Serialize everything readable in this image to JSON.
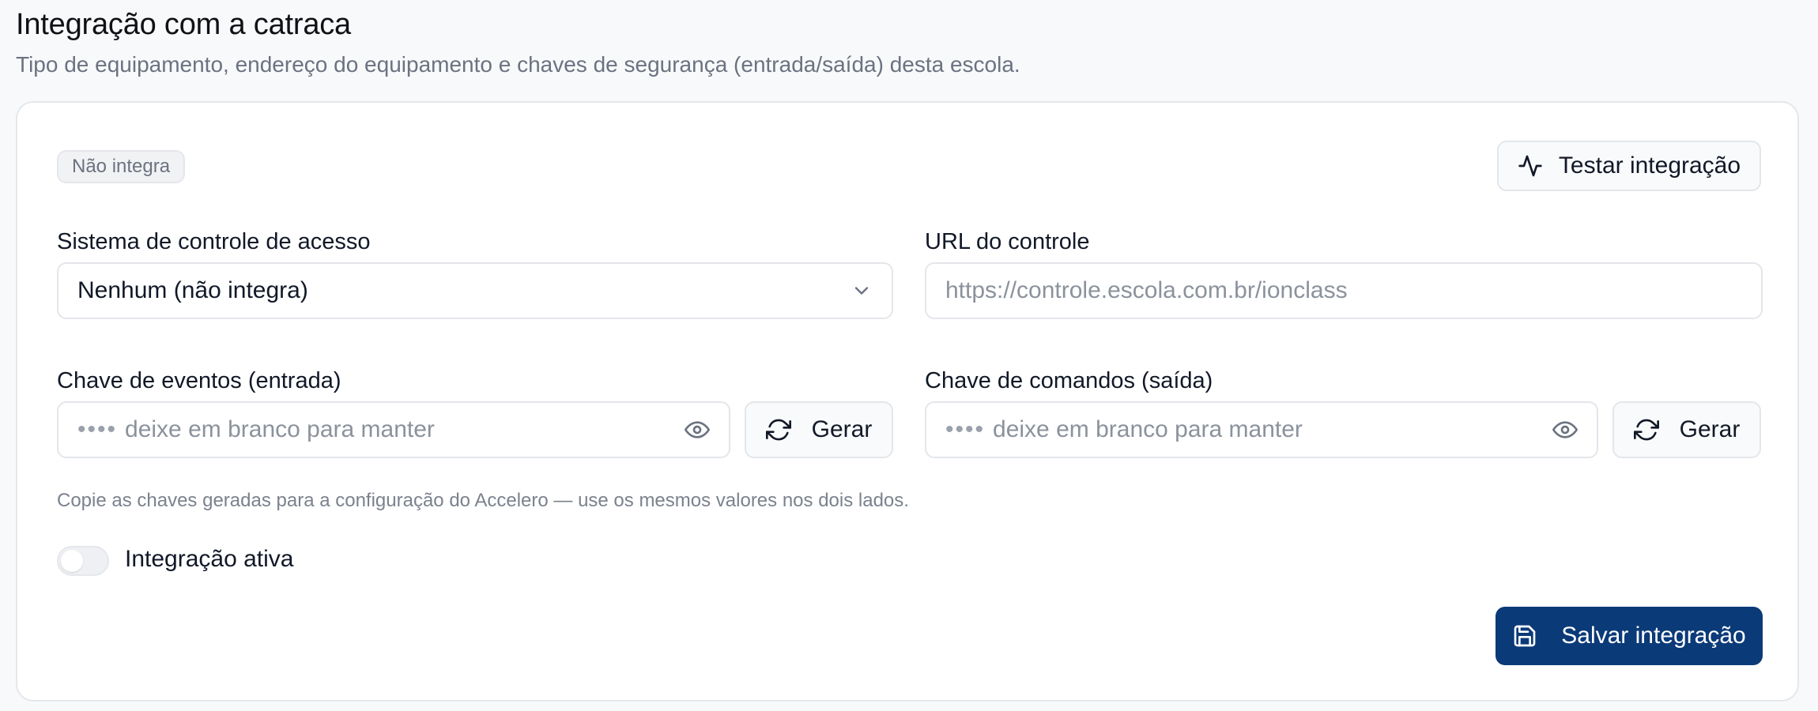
{
  "header": {
    "title": "Integração com a catraca",
    "subtitle": "Tipo de equipamento, endereço do equipamento e chaves de segurança (entrada/saída) desta escola."
  },
  "card": {
    "status_badge": "Não integra",
    "test_button_label": "Testar integração",
    "access_system": {
      "label": "Sistema de controle de acesso",
      "selected": "Nenhum (não integra)"
    },
    "url": {
      "label": "URL do controle",
      "placeholder": "https://controle.escola.com.br/ionclass"
    },
    "event_key": {
      "label": "Chave de eventos (entrada)",
      "dots": "••••",
      "placeholder": "deixe em branco para manter",
      "generate_label": "Gerar"
    },
    "command_key": {
      "label": "Chave de comandos (saída)",
      "dots": "••••",
      "placeholder": "deixe em branco para manter",
      "generate_label": "Gerar"
    },
    "hint": "Copie as chaves geradas para a configuração do Accelero — use os mesmos valores nos dois lados.",
    "toggle": {
      "label": "Integração ativa",
      "on": false
    },
    "save_button_label": "Salvar integração"
  },
  "icons": {
    "test": "activity-icon",
    "select": "chevron-down-icon",
    "reveal": "eye-icon",
    "generate": "refresh-icon",
    "save": "save-icon"
  },
  "colors": {
    "primary": "#0b3a78",
    "background": "#f8f9fb",
    "border": "#e4e7eb",
    "muted_text": "#6b7280"
  }
}
